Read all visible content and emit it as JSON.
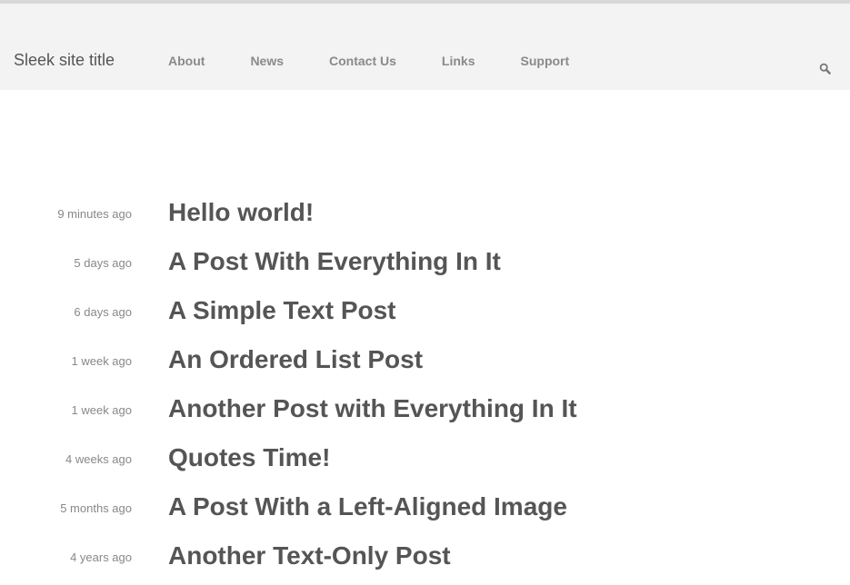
{
  "header": {
    "site_title": "Sleek site title",
    "nav": [
      {
        "label": "About"
      },
      {
        "label": "News"
      },
      {
        "label": "Contact Us"
      },
      {
        "label": "Links"
      },
      {
        "label": "Support"
      }
    ],
    "search_icon": "search-icon"
  },
  "posts": [
    {
      "time": "9 minutes ago",
      "title": "Hello world!"
    },
    {
      "time": "5 days ago",
      "title": "A Post With Everything In It"
    },
    {
      "time": "6 days ago",
      "title": "A Simple Text Post"
    },
    {
      "time": "1 week ago",
      "title": "An Ordered List Post"
    },
    {
      "time": "1 week ago",
      "title": "Another Post with Everything In It"
    },
    {
      "time": "4 weeks ago",
      "title": "Quotes Time!"
    },
    {
      "time": "5 months ago",
      "title": "A Post With a Left-Aligned Image"
    },
    {
      "time": "4 years ago",
      "title": "Another Text-Only Post"
    }
  ],
  "colors": {
    "header_bg": "#f3f3f3",
    "title_text": "#555555",
    "nav_text": "#8a8a8a",
    "meta_text": "#888888"
  }
}
